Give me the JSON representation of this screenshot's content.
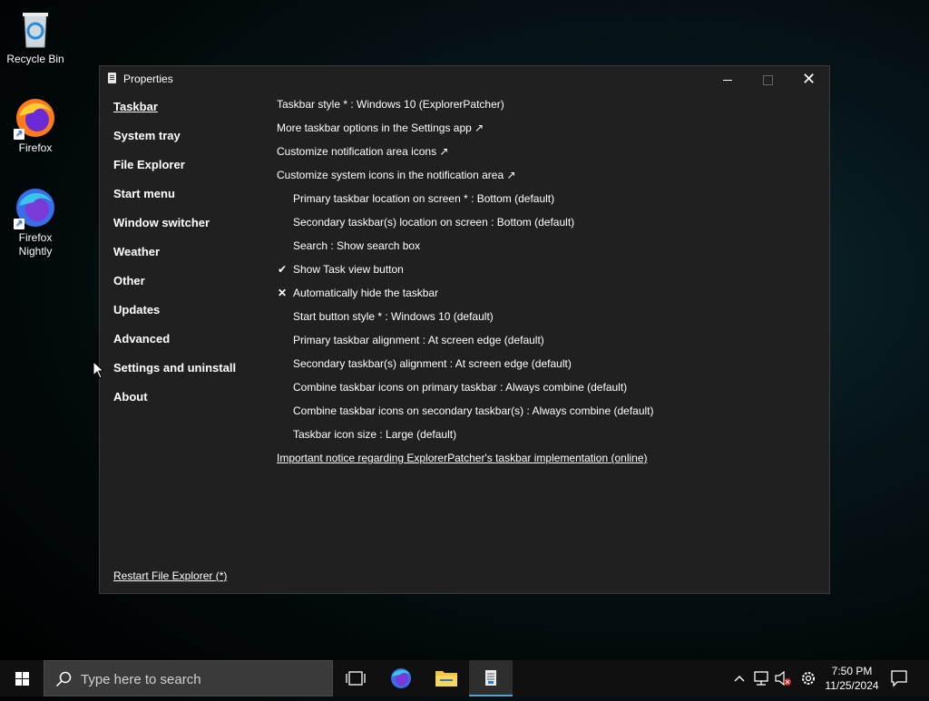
{
  "desktop": {
    "icons": [
      {
        "label": "Recycle Bin"
      },
      {
        "label": "Firefox"
      },
      {
        "label": "Firefox Nightly"
      }
    ]
  },
  "window": {
    "title": "Properties",
    "minimize_glyph": "",
    "close_glyph": "✕"
  },
  "sidebar": {
    "items": [
      {
        "label": "Taskbar",
        "active": true
      },
      {
        "label": "System tray"
      },
      {
        "label": "File Explorer"
      },
      {
        "label": "Start menu"
      },
      {
        "label": "Window switcher"
      },
      {
        "label": "Weather"
      },
      {
        "label": "Other"
      },
      {
        "label": "Updates"
      },
      {
        "label": "Advanced"
      },
      {
        "label": "Settings and uninstall"
      },
      {
        "label": "About"
      }
    ],
    "restart_link": "Restart File Explorer (*)"
  },
  "options": [
    {
      "label": "Taskbar style * : Windows 10 (ExplorerPatcher)"
    },
    {
      "label": "More taskbar options in the Settings app ↗"
    },
    {
      "label": "Customize notification area icons ↗"
    },
    {
      "label": "Customize system icons in the notification area ↗"
    },
    {
      "label": "Primary taskbar location on screen * : Bottom (default)"
    },
    {
      "label": "Secondary taskbar(s) location on screen : Bottom (default)"
    },
    {
      "label": "Search : Show search box"
    },
    {
      "label": "Show Task view button",
      "mark": "✔"
    },
    {
      "label": "Automatically hide the taskbar",
      "mark": "✕"
    },
    {
      "label": "Start button style * : Windows 10 (default)"
    },
    {
      "label": "Primary taskbar alignment : At screen edge (default)"
    },
    {
      "label": "Secondary taskbar(s) alignment : At screen edge (default)"
    },
    {
      "label": "Combine taskbar icons on primary taskbar : Always combine (default)"
    },
    {
      "label": "Combine taskbar icons on secondary taskbar(s) : Always combine (default)"
    },
    {
      "label": "Taskbar icon size : Large (default)"
    },
    {
      "label": "Important notice regarding ExplorerPatcher's taskbar implementation (online)"
    }
  ],
  "taskbar": {
    "search_placeholder": "Type here to search",
    "clock_time": "7:50 PM",
    "clock_date": "11/25/2024"
  },
  "colors": {
    "window_bg": "#202020",
    "taskbar_bg": "#101010",
    "active_indicator": "#4aa3df"
  }
}
